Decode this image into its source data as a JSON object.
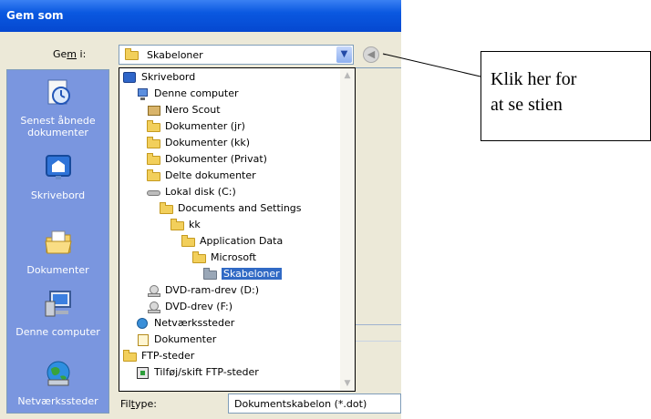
{
  "dialog": {
    "title": "Gem som",
    "lookin_label_pre": "Ge",
    "lookin_label_underlined": "m",
    "lookin_label_post": " i:",
    "lookin_value": "Skabeloner",
    "filetype_label_pre": "Fil",
    "filetype_label_underlined": "t",
    "filetype_label_post": "ype:",
    "filetype_value": "Dokumentskabelon (*.dot)"
  },
  "places": [
    {
      "label": "Senest åbnede\ndokumenter",
      "icon": "recent-documents-icon"
    },
    {
      "label": "Skrivebord",
      "icon": "desktop-icon"
    },
    {
      "label": "Dokumenter",
      "icon": "documents-icon"
    },
    {
      "label": "Denne computer",
      "icon": "my-computer-icon"
    },
    {
      "label": "Netværkssteder",
      "icon": "network-places-icon"
    }
  ],
  "dropdown": {
    "items": [
      {
        "label": "Skrivebord",
        "icon": "desktop-icon"
      },
      {
        "label": "Denne computer",
        "icon": "my-computer-icon"
      },
      {
        "label": "Nero Scout",
        "icon": "nero-scout-icon"
      },
      {
        "label": "Dokumenter (jr)",
        "icon": "folder-icon"
      },
      {
        "label": "Dokumenter (kk)",
        "icon": "folder-icon"
      },
      {
        "label": "Dokumenter (Privat)",
        "icon": "folder-icon"
      },
      {
        "label": "Delte dokumenter",
        "icon": "folder-icon"
      },
      {
        "label": "Lokal disk (C:)",
        "icon": "hard-disk-icon"
      },
      {
        "label": "Documents and Settings",
        "icon": "folder-icon"
      },
      {
        "label": "kk",
        "icon": "folder-icon"
      },
      {
        "label": "Application Data",
        "icon": "folder-icon"
      },
      {
        "label": "Microsoft",
        "icon": "folder-icon"
      },
      {
        "label": "Skabeloner",
        "icon": "folder-icon",
        "selected": true
      },
      {
        "label": "DVD-ram-drev (D:)",
        "icon": "dvd-drive-icon"
      },
      {
        "label": "DVD-drev (F:)",
        "icon": "dvd-drive-icon"
      },
      {
        "label": "Netværkssteder",
        "icon": "network-places-icon"
      },
      {
        "label": "Dokumenter",
        "icon": "documents-icon"
      },
      {
        "label": "FTP-steder",
        "icon": "folder-icon"
      },
      {
        "label": "Tilføj/skift FTP-steder",
        "icon": "ftp-edit-icon"
      }
    ]
  },
  "callout": {
    "line1": "Klik her for",
    "line2": "at se stien"
  },
  "colors": {
    "title_bar": "#0548d0",
    "places_bar": "#7a96df",
    "selection": "#316ac5",
    "dialog_face": "#ece9d8"
  }
}
